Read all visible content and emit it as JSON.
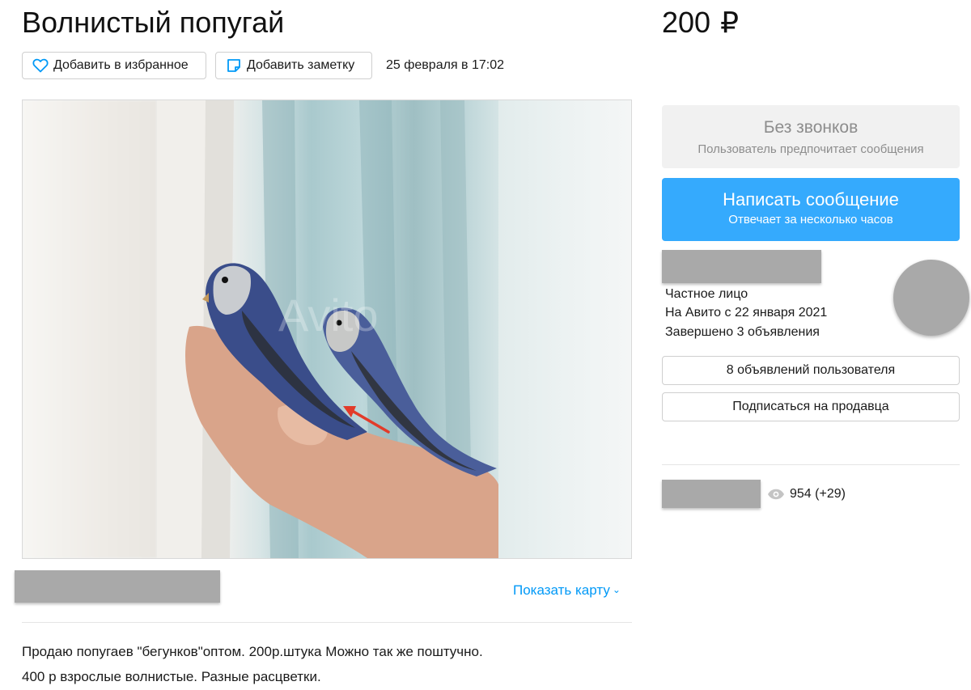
{
  "listing": {
    "title": "Волнистый попугай",
    "price": "200",
    "currency": "₽",
    "date": "25 февраля в 17:02"
  },
  "actions": {
    "favorite_label": "Добавить в избранное",
    "note_label": "Добавить заметку"
  },
  "gallery": {
    "watermark": "Avito"
  },
  "map": {
    "show_label": "Показать карту"
  },
  "description": {
    "line1": "Продаю попугаев \"бегунков\"оптом. 200р.штука Можно так же поштучно.",
    "line2": "400 р взрослые волнистые. Разные расцветки."
  },
  "contact": {
    "nocall_title": "Без звонков",
    "nocall_sub": "Пользователь предпочитает сообщения",
    "message_title": "Написать сообщение",
    "message_sub": "Отвечает за несколько часов"
  },
  "seller": {
    "type": "Частное лицо",
    "since": "На Авито с 22 января 2021",
    "completed": "Завершено 3 объявления",
    "ads_label": "8 объявлений пользователя",
    "subscribe_label": "Подписаться на продавца"
  },
  "stats": {
    "views": "954 (+29)"
  },
  "colors": {
    "accent": "#35aafd",
    "link": "#0099f7",
    "muted": "#8d8d8d",
    "redacted": "#a9a9a9"
  }
}
